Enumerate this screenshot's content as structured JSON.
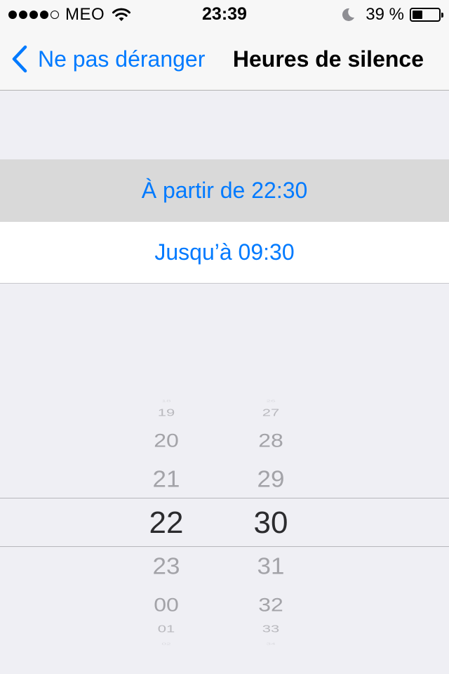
{
  "status_bar": {
    "carrier": "MEO",
    "time": "23:39",
    "battery_text": "39 %",
    "battery_level": 0.39,
    "signal_dots_filled": 4,
    "signal_dots_total": 5,
    "icons": [
      "wifi-icon",
      "moon-icon",
      "battery-icon"
    ]
  },
  "nav": {
    "back_label": "Ne pas déranger",
    "title": "Heures de silence"
  },
  "rows": {
    "from_label": "À partir de 22:30",
    "to_label": "Jusqu’à 09:30"
  },
  "picker": {
    "hours": [
      "18",
      "19",
      "20",
      "21",
      "22",
      "23",
      "00",
      "01",
      "02"
    ],
    "minutes": [
      "26",
      "27",
      "28",
      "29",
      "30",
      "31",
      "32",
      "33",
      "34"
    ],
    "selected_hour": "22",
    "selected_minute": "30"
  },
  "colors": {
    "accent": "#007aff",
    "background": "#efeff4",
    "selected_row": "#d9d9d9"
  }
}
